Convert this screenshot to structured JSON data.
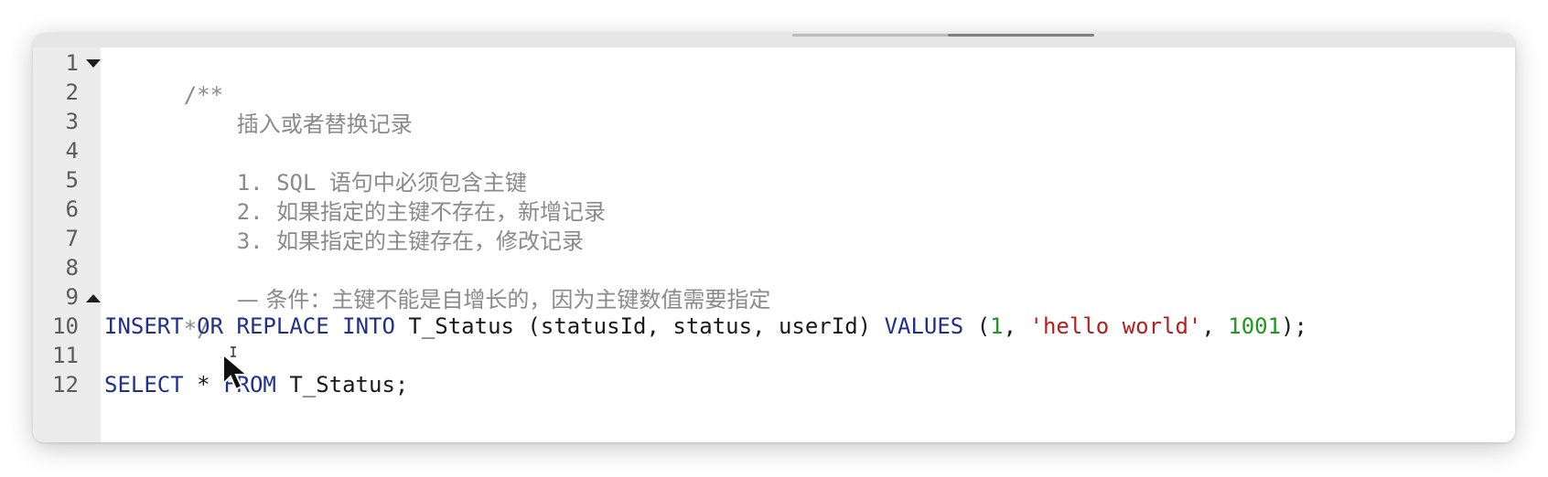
{
  "editor": {
    "line_numbers": [
      "1",
      "2",
      "3",
      "4",
      "5",
      "6",
      "7",
      "8",
      "9",
      "10",
      "11",
      "12"
    ],
    "comment": {
      "open": "/**",
      "title": "插入或者替换记录",
      "item1_num": "1.",
      "item1_code": "SQL",
      "item1_text": "语句中必须包含主键",
      "item2_num": "2.",
      "item2_text": "如果指定的主键不存在，新增记录",
      "item3_num": "3.",
      "item3_text": "如果指定的主键存在，修改记录",
      "item4": "— 条件：主键不能是自增长的，因为主键数值需要指定",
      "close": "*/"
    },
    "insert_stmt": {
      "kw_insert": "INSERT",
      "kw_or": "OR",
      "kw_replace": "REPLACE",
      "kw_into": "INTO",
      "table_name": "T_Status",
      "columns": "(statusId, status, userId)",
      "kw_values": "VALUES",
      "paren_open": "(",
      "val_id": "1",
      "sep1": ", ",
      "val_status": "'hello world'",
      "sep2": ", ",
      "val_user": "1001",
      "paren_close": ");"
    },
    "select_stmt": {
      "kw_select": "SELECT",
      "star": "*",
      "kw_from": "FROM",
      "table_name": "T_Status;"
    }
  },
  "colors": {
    "keyword": "#1f2f8f",
    "number": "#1d9a1d",
    "string": "#b41e1e",
    "comment": "#8a8a8a",
    "gutter_bg": "#ececec"
  }
}
